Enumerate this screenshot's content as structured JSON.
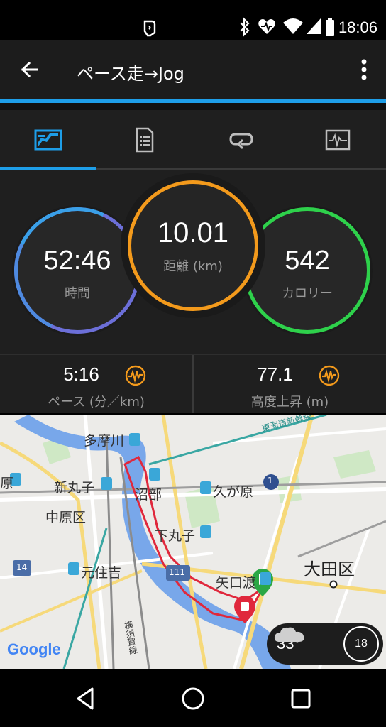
{
  "status_bar": {
    "time": "18:06",
    "icons": [
      "nfc-icon",
      "bluetooth-icon",
      "heart-rate-icon",
      "wifi-icon",
      "signal-icon",
      "battery-icon"
    ]
  },
  "app_bar": {
    "title": "ペース走→Jog",
    "back_icon": "arrow-left-icon",
    "menu_icon": "more-vert-icon"
  },
  "tabs": [
    {
      "name": "overview",
      "icon": "overview-icon",
      "selected": true
    },
    {
      "name": "details",
      "icon": "document-icon",
      "selected": false
    },
    {
      "name": "laps",
      "icon": "loop-icon",
      "selected": false
    },
    {
      "name": "charts",
      "icon": "activity-chart-icon",
      "selected": false
    }
  ],
  "stats": {
    "time": {
      "value": "52:46",
      "label": "時間"
    },
    "distance": {
      "value": "10.01",
      "label": "距離 (km)"
    },
    "calories": {
      "value": "542",
      "label": "カロリー"
    }
  },
  "substats": {
    "pace": {
      "value": "5:16",
      "label": "ペース (分／km)"
    },
    "elevation": {
      "value": "77.1",
      "label": "高度上昇 (m)"
    }
  },
  "colors": {
    "accent": "#1e9ee8",
    "time_ring": "#6c6fd8",
    "distance_ring": "#f39a1c",
    "calories_ring": "#2ed14b",
    "pulse_icon": "#f39a1c",
    "route": "#e0283c"
  },
  "map": {
    "labels": {
      "tamagawa": "多摩川",
      "shinmaruko": "新丸子",
      "numabe": "沼部",
      "kugahara": "久が原",
      "nakahara": "中原区",
      "shimomaruko": "下丸子",
      "motosumiyoshi": "元住吉",
      "yaguchi": "矢口渡",
      "ota": "大田区",
      "tokaido": "東海道新幹線",
      "yokosuka": "横須賀線",
      "ra": "原",
      "road1": "1",
      "road14": "14",
      "road111": "111"
    },
    "attribution": "Google",
    "weather": {
      "temp": "33°",
      "wind": "18",
      "icon": "cloud-icon"
    }
  },
  "nav": {
    "back": "nav-back-icon",
    "home": "nav-home-icon",
    "recents": "nav-recents-icon"
  }
}
